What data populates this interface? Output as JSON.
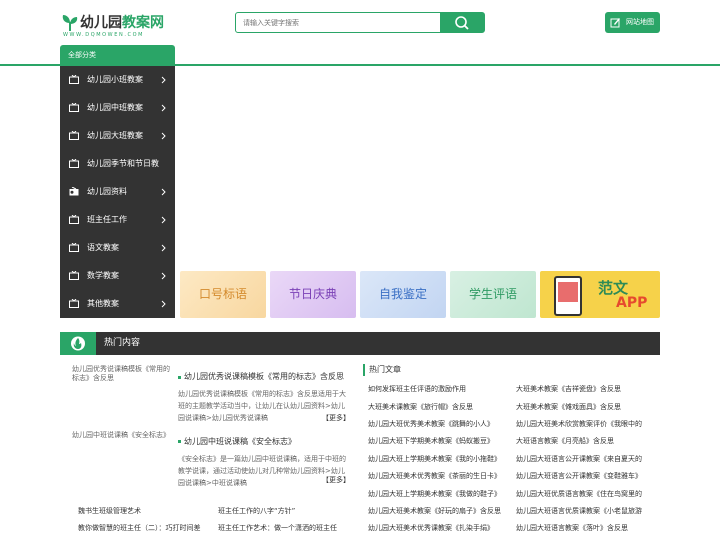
{
  "header": {
    "logo_text_a": "幼儿园",
    "logo_text_b": "教案网",
    "logo_url": "WWW.DQMOWEN.COM",
    "search_placeholder": "请输入关键字搜索",
    "sitemap_label": "网站地图"
  },
  "category": {
    "heading": "全部分类",
    "items": [
      {
        "label": "幼儿园小班教案"
      },
      {
        "label": "幼儿园中班教案"
      },
      {
        "label": "幼儿园大班教案"
      },
      {
        "label": "幼儿园季节和节日教"
      },
      {
        "label": "幼儿园资料"
      },
      {
        "label": "班主任工作"
      },
      {
        "label": "语文教案"
      },
      {
        "label": "数学教案"
      },
      {
        "label": "其他教案"
      }
    ]
  },
  "banners": [
    {
      "label": "口号标语",
      "color": "#f2b866"
    },
    {
      "label": "节日庆典",
      "color": "#9a6bcf"
    },
    {
      "label": "自我鉴定",
      "color": "#5b8fd6"
    },
    {
      "label": "学生评语",
      "color": "#4caf7a"
    },
    {
      "label": "范文",
      "label2": "APP",
      "color": "#f6c63c"
    }
  ],
  "hot": {
    "heading": "热门内容",
    "articles": [
      {
        "img_alt": "幼儿园优秀说课稿模板《常用的标志》含反思",
        "title": "幼儿园优秀说课稿模板《常用的标志》含反思",
        "desc": "幼儿园优秀说课稿模板《常用的标志》含反思适用于大班的主题教学活动当中，让幼儿在认幼儿园资料>幼儿园说课稿>幼儿园优秀说课稿",
        "more": "【更多】"
      },
      {
        "img_alt": "幼儿园中班说课稿《安全标志》",
        "title": "幼儿园中班说课稿《安全标志》",
        "desc": "《安全标志》是一篇幼儿园中班说课稿，适用于中班的教学说课，通过活动使幼儿对几种常幼儿园资料>幼儿园说课稿>中班说课稿",
        "more": "【更多】"
      }
    ],
    "tips": [
      "魏书生班级管理艺术",
      "班主任工作的八字“方针”",
      "教你做智慧的班主任（二）：巧打时间差",
      "班主任工作艺术：做一个潇洒的班主任"
    ]
  },
  "hotlist": {
    "heading": "热门文章",
    "left": [
      "如何发挥班主任评语的激励作用",
      "大班美术课教案《旅行帽》含反思",
      "幼儿园大班优秀美术教案《跳舞的小人》",
      "幼儿园大班下学期美术教案《蚂蚁搬豆》",
      "幼儿园大班上学期美术教案《我的小拖鞋》",
      "幼儿园大班美术优秀教案《茶丽的生日卡》",
      "幼儿园大班上学期美术教案《我做的鞋子》",
      "幼儿园大班美术教案《好玩的扇子》含反思",
      "幼儿园大班美术优秀课教案《扎染手绢》"
    ],
    "right": [
      "大班美术教案《吉祥瓷盘》含反思",
      "大班美术教案《傩戏面具》含反思",
      "幼儿园大班美术欣赏教案评价《我眼中的",
      "大班语言教案《月亮船》含反思",
      "幼儿园大班语言公开课教案《来自夏天的",
      "幼儿园大班语言公开课教案《变鞋雅车》",
      "幼儿园大班优质语言教案《住在鸟窝里的",
      "幼儿园大班语言优质课教案《小老鼠旅游",
      "幼儿园大班语言教案《落叶》含反思"
    ]
  }
}
